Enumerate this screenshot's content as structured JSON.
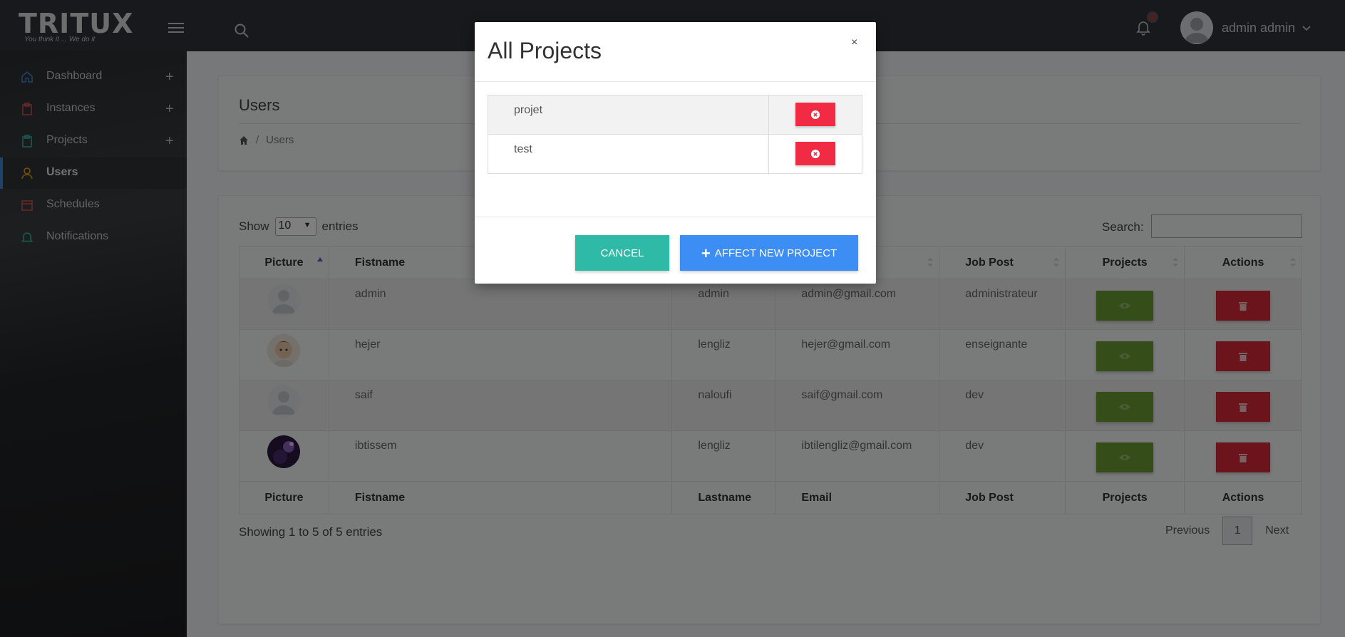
{
  "brand": {
    "logo_text": "TRITUX",
    "tagline": "You think it ... We do it"
  },
  "topbar": {
    "user_name": "admin admin",
    "icons": [
      "menu-icon",
      "search-icon",
      "bell-icon",
      "chevron-down-icon"
    ]
  },
  "sidebar": {
    "items": [
      {
        "label": "Dashboard",
        "icon": "home-icon",
        "color": "#3a85d8",
        "expandable": true
      },
      {
        "label": "Instances",
        "icon": "clipboard-icon",
        "color": "#d9534f",
        "expandable": true
      },
      {
        "label": "Projects",
        "icon": "clipboard-icon",
        "color": "#2ebaa6",
        "expandable": true
      },
      {
        "label": "Users",
        "icon": "user-icon",
        "color": "#e8a300",
        "expandable": false,
        "active": true
      },
      {
        "label": "Schedules",
        "icon": "calendar-icon",
        "color": "#d9534f",
        "expandable": false
      },
      {
        "label": "Notifications",
        "icon": "bell-icon",
        "color": "#2ebaa6",
        "expandable": false
      }
    ],
    "plus": "+"
  },
  "header_panel": {
    "title": "Users",
    "breadcrumb": {
      "current": "Users",
      "separator": "/"
    }
  },
  "table_controls": {
    "show": "Show",
    "entries_value": "10",
    "entries": "entries",
    "search_label": "Search:"
  },
  "users_table": {
    "columns": [
      "Picture",
      "Fistname",
      "Lastname",
      "Email",
      "Job Post",
      "Projects",
      "Actions"
    ],
    "rows": [
      {
        "firstname": "admin",
        "lastname": "admin",
        "email": "admin@gmail.com",
        "job": "administrateur",
        "avatar": "default"
      },
      {
        "firstname": "hejer",
        "lastname": "lengliz",
        "email": "hejer@gmail.com",
        "job": "enseignante",
        "avatar": "photo-child"
      },
      {
        "firstname": "saif",
        "lastname": "naloufi",
        "email": "saif@gmail.com",
        "job": "dev",
        "avatar": "default"
      },
      {
        "firstname": "ibtissem",
        "lastname": "lengliz",
        "email": "ibtilengliz@gmail.com",
        "job": "dev",
        "avatar": "photo-dark"
      }
    ]
  },
  "footer": {
    "showing": "Showing 1 to 5 of 5 entries",
    "previous": "Previous",
    "page": "1",
    "next": "Next"
  },
  "modal": {
    "title": "All Projects",
    "close": "×",
    "projects": [
      {
        "name": "projet"
      },
      {
        "name": "test"
      }
    ],
    "cancel": "CANCEL",
    "affect": "AFFECT NEW PROJECT"
  },
  "colors": {
    "view_button": "#6b9a33",
    "delete_button": "#d72836",
    "cancel_button": "#2ebaa6",
    "affect_button": "#3c8df4",
    "remove_button": "#f22b45"
  }
}
